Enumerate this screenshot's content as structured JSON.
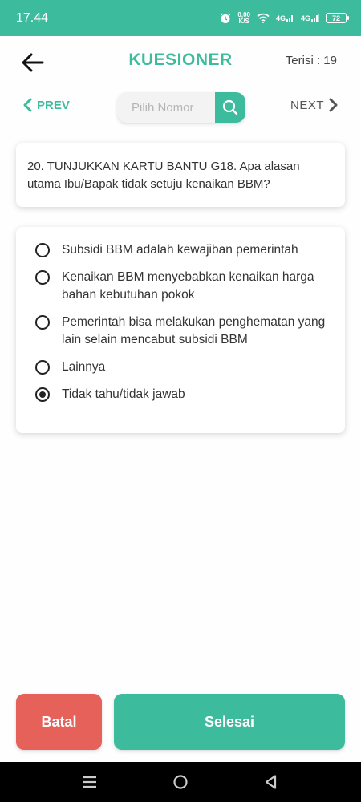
{
  "status_bar": {
    "time": "17.44",
    "speed_value": "0,00",
    "speed_unit": "K/S",
    "network_1": "4G",
    "network_2": "4G",
    "battery": "72"
  },
  "header": {
    "title": "KUESIONER",
    "counter": "Terisi : 19"
  },
  "nav": {
    "prev_label": "PREV",
    "next_label": "NEXT",
    "search_placeholder": "Pilih Nomor"
  },
  "question": {
    "text": "20. TUNJUKKAN KARTU BANTU G18. Apa alasan utama Ibu/Bapak tidak setuju kenaikan BBM?"
  },
  "options": [
    {
      "label": "Subsidi BBM adalah kewajiban pemerintah",
      "selected": false
    },
    {
      "label": "Kenaikan BBM menyebabkan kenaikan harga bahan kebutuhan pokok",
      "selected": false
    },
    {
      "label": "Pemerintah bisa melakukan penghematan yang lain selain mencabut subsidi BBM",
      "selected": false
    },
    {
      "label": "Lainnya",
      "selected": false
    },
    {
      "label": "Tidak tahu/tidak jawab",
      "selected": true
    }
  ],
  "actions": {
    "cancel_label": "Batal",
    "finish_label": "Selesai"
  },
  "colors": {
    "primary": "#3dbb9d",
    "danger": "#e5615a"
  }
}
